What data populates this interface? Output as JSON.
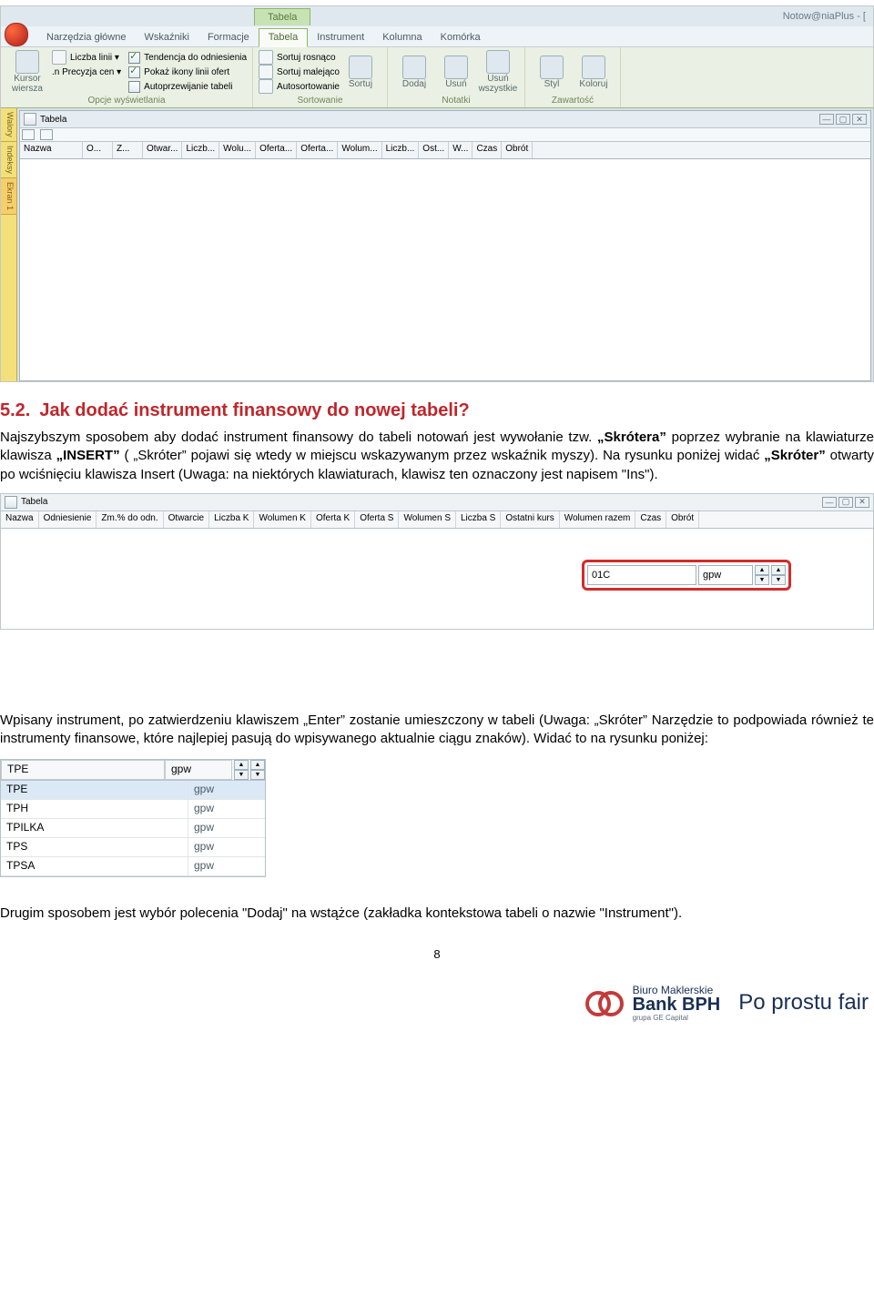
{
  "ribbon": {
    "context_tab": "Tabela",
    "app_title": "Notow@niaPlus - [",
    "tabs": [
      "Narzędzia główne",
      "Wskaźniki",
      "Formacje",
      "Tabela",
      "Instrument",
      "Kolumna",
      "Komórka"
    ],
    "group1": {
      "big": "Kursor\nwiersza",
      "row1a": "Liczba linii ▾",
      "row2a": ".n Precyzja cen ▾",
      "chk1": "Tendencja do odniesienia",
      "chk2": "Pokaż ikony linii ofert",
      "chk3": "Autoprzewijanie tabeli",
      "label": "Opcje wyświetlania"
    },
    "group2": {
      "r1": "Sortuj rosnąco",
      "r2": "Sortuj malejąco",
      "r3": "Autosortowanie",
      "big": "Sortuj",
      "label": "Sortowanie"
    },
    "group3": {
      "b1": "Dodaj",
      "b2": "Usuń",
      "b3": "Usuń\nwszystkie",
      "label": "Notatki"
    },
    "group4": {
      "b1": "Styl",
      "b2": "Koloruj",
      "label": "Zawartość"
    }
  },
  "vtabs": [
    "Walory",
    "Indeksy",
    "Ekran 1"
  ],
  "innerwin": {
    "title": "Tabela",
    "cols": [
      "Nazwa",
      "O...",
      "Z...",
      "Otwar...",
      "Liczb...",
      "Wolu...",
      "Oferta...",
      "Oferta...",
      "Wolum...",
      "Liczb...",
      "Ost...",
      "W...",
      "Czas",
      "Obrót"
    ]
  },
  "section": {
    "num": "5.2.",
    "title": "Jak dodać instrument finansowy do nowej tabeli?",
    "p1a": "Najszybszym sposobem aby dodać instrument finansowy do tabeli notowań jest wywołanie tzw. ",
    "p1b": "„Skrótera”",
    "p1c": " poprzez wybranie na klawiaturze klawisza ",
    "p1d": "„INSERT”",
    "p1e": " ( „Skróter” pojawi się wtedy w miejscu wskazywanym przez wskaźnik myszy). Na rysunku poniżej widać ",
    "p1f": "„Skróter”",
    "p1g": " otwarty po wciśnięciu klawisza Insert (Uwaga: na niektórych klawiaturach, klawisz ten oznaczony jest napisem \"Ins\").",
    "p2": "Wpisany instrument, po zatwierdzeniu klawiszem „Enter” zostanie umieszczony w tabeli (Uwaga: „Skróter” Narzędzie to podpowiada również te instrumenty finansowe, które najlepiej pasują do wpisywanego aktualnie ciągu znaków). Widać to na rysunku poniżej:",
    "p3": "Drugim sposobem jest wybór polecenia \"Dodaj\" na wstążce (zakładka kontekstowa tabeli o nazwie \"Instrument\")."
  },
  "shot2": {
    "title": "Tabela",
    "cols": [
      "Nazwa",
      "Odniesienie",
      "Zm.% do odn.",
      "Otwarcie",
      "Liczba K",
      "Wolumen K",
      "Oferta K",
      "Oferta S",
      "Wolumen S",
      "Liczba S",
      "Ostatni kurs",
      "Wolumen razem",
      "Czas",
      "Obrót"
    ],
    "input1": "01C",
    "input2": "gpw"
  },
  "shot3": {
    "top_a": "TPE",
    "top_b": "gpw",
    "rows": [
      {
        "a": "TPE",
        "b": "gpw",
        "sel": true
      },
      {
        "a": "TPH",
        "b": "gpw"
      },
      {
        "a": "TPILKA",
        "b": "gpw"
      },
      {
        "a": "TPS",
        "b": "gpw"
      },
      {
        "a": "TPSA",
        "b": "gpw"
      }
    ]
  },
  "pageno": "8",
  "footer": {
    "l1": "Biuro Maklerskie",
    "l2": "Bank BPH",
    "l3": "grupa GE Capital",
    "slogan": "Po prostu fair"
  }
}
